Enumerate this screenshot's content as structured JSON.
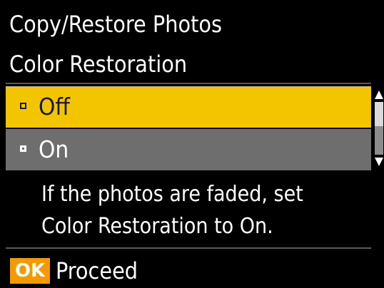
{
  "header": {
    "title": "Copy/Restore Photos",
    "subtitle": "Color Restoration"
  },
  "options": [
    {
      "label": "Off",
      "selected": true
    },
    {
      "label": "On",
      "selected": false
    }
  ],
  "message": {
    "line1": "If the photos are faded, set",
    "line2": "Color Restoration to On."
  },
  "footer": {
    "ok_badge": "OK",
    "proceed_label": "Proceed"
  },
  "colors": {
    "background": "#000000",
    "highlight": "#f3c400",
    "unselected_row": "#6e6e6e",
    "ok_badge": "#f39a00",
    "text": "#ffffff"
  },
  "scrollbar": {
    "up_icon": "arrow-up-icon",
    "down_icon": "arrow-down-icon"
  }
}
